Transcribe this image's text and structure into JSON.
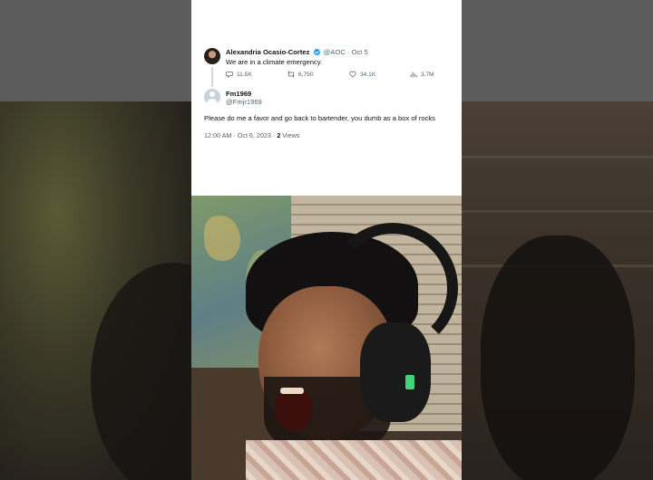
{
  "quoted_tweet": {
    "author_name": "Alexandria Ocasio-Cortez",
    "handle_and_date": "@AOC · Oct 5",
    "text": "We are in a climate emergency.",
    "stats": {
      "replies": "11.5K",
      "retweets": "6,750",
      "likes": "34.1K",
      "views": "3.7M"
    }
  },
  "reply_tweet": {
    "author_name": "Fm1969",
    "handle": "@Fmjr1969",
    "text": "Please do me a favor and go back to bartender, you dumb as a box of rocks",
    "timestamp": "12:00 AM · Oct 6, 2023 · ",
    "views_count": "2",
    "views_label": " Views"
  },
  "colors": {
    "verified_badge": "#1d9bf0",
    "text_primary": "#0f1419",
    "text_secondary": "#536471",
    "card_background": "#ffffff"
  },
  "icons": [
    "verified-badge-icon",
    "reply-icon",
    "retweet-icon",
    "like-icon",
    "views-icon",
    "default-avatar-icon"
  ]
}
